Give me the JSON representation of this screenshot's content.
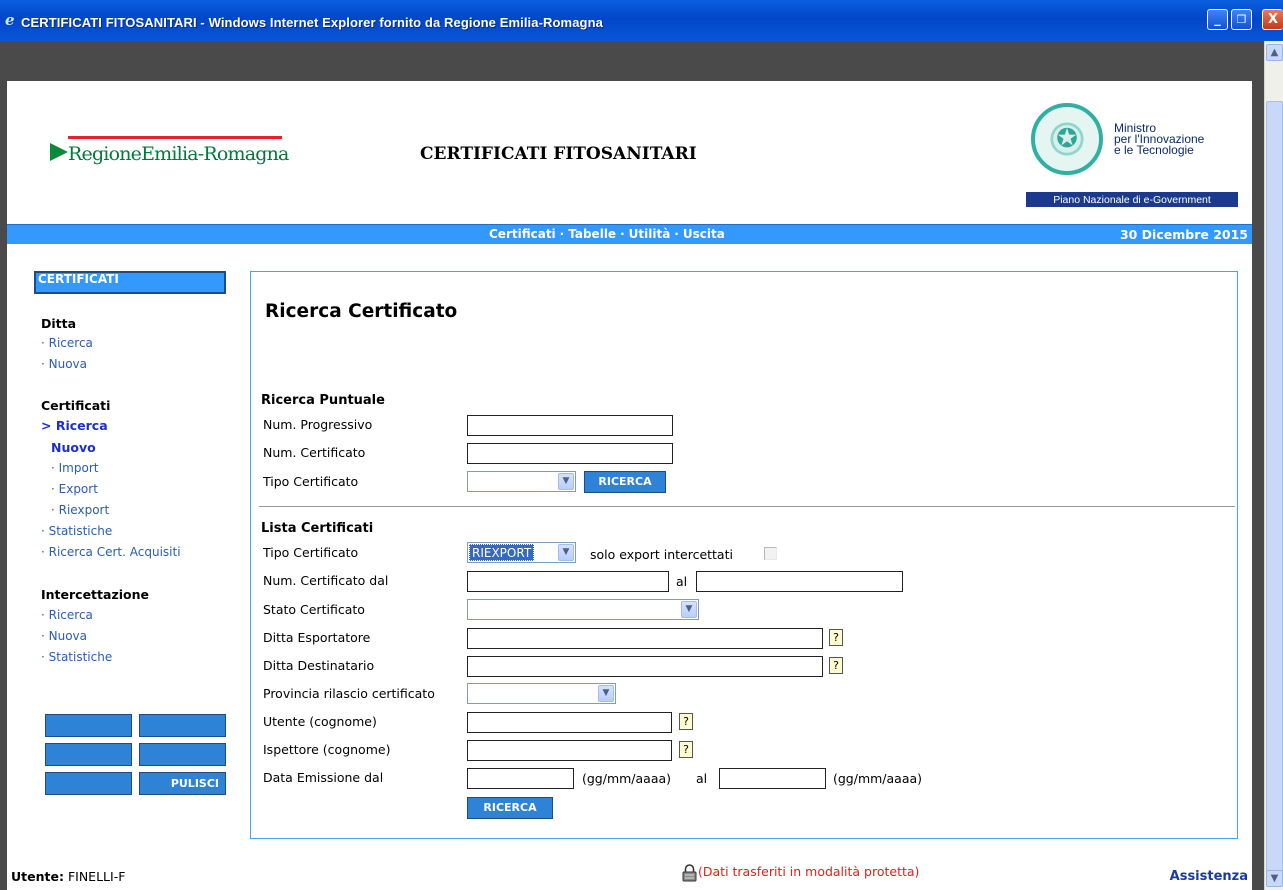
{
  "window": {
    "title": "CERTIFICATI FITOSANITARI - Windows Internet Explorer fornito da Regione Emilia-Romagna",
    "minimize": "_",
    "restore": "❐",
    "close": "X"
  },
  "header": {
    "region_logo_text": "RegioneEmilia-Romagna",
    "app_title": "CERTIFICATI FITOSANITARI",
    "ministry_line1": "Ministro",
    "ministry_line2": "per l'Innovazione",
    "ministry_line3": "e le Tecnologie",
    "ministry_band": "Piano Nazionale di e-Government"
  },
  "nav": {
    "items": [
      "Certificati",
      "Tabelle",
      "Utilità",
      "Uscita"
    ],
    "separator": "·",
    "date": "30 Dicembre 2015"
  },
  "sidebar": {
    "section_title": "CERTIFICATI",
    "groups": [
      {
        "heading": "Ditta",
        "items": [
          "· Ricerca",
          "· Nuova"
        ]
      },
      {
        "heading": "Certificati",
        "items": [
          "> Ricerca",
          "Nuovo",
          "· Import",
          "· Export",
          "· Riexport",
          "· Statistiche",
          "· Ricerca Cert. Acquisiti"
        ]
      },
      {
        "heading": "Intercettazione",
        "items": [
          "· Ricerca",
          "· Nuova",
          "· Statistiche"
        ]
      }
    ],
    "buttons": [
      "",
      "",
      "",
      "",
      "",
      "PULISCI"
    ]
  },
  "main": {
    "page_title": "Ricerca Certificato",
    "puntuale": {
      "heading": "Ricerca Puntuale",
      "num_progressivo_label": "Num. Progressivo",
      "num_progressivo_value": "",
      "num_certificato_label": "Num. Certificato",
      "num_certificato_value": "",
      "tipo_certificato_label": "Tipo Certificato",
      "tipo_certificato_value": "",
      "search_button": "RICERCA"
    },
    "lista": {
      "heading": "Lista Certificati",
      "tipo_certificato_label": "Tipo Certificato",
      "tipo_certificato_value": "RIEXPORT",
      "solo_export_label": "solo export intercettati",
      "solo_export_checked": false,
      "num_dal_label": "Num. Certificato dal",
      "al_label": "al",
      "stato_label": "Stato Certificato",
      "stato_value": "",
      "esportatore_label": "Ditta Esportatore",
      "destinatario_label": "Ditta Destinatario",
      "provincia_label": "Provincia rilascio certificato",
      "provincia_value": "",
      "utente_label": "Utente (cognome)",
      "ispettore_label": "Ispettore (cognome)",
      "data_dal_label": "Data Emissione dal",
      "date_format_hint": "(gg/mm/aaaa)",
      "data_al_label": "al",
      "help": "?",
      "search_button": "RICERCA"
    }
  },
  "footer": {
    "user_label": "Utente:",
    "user_value": "FINELLI-F",
    "secure_text": "(Dati trasferiti in modalità protetta)",
    "assistance": "Assistenza"
  },
  "colors": {
    "nav_blue": "#3399ff",
    "button_blue": "#2e83d6",
    "link_blue": "#2a5db0",
    "secure_red": "#e0201a",
    "region_green": "#007a3a"
  }
}
